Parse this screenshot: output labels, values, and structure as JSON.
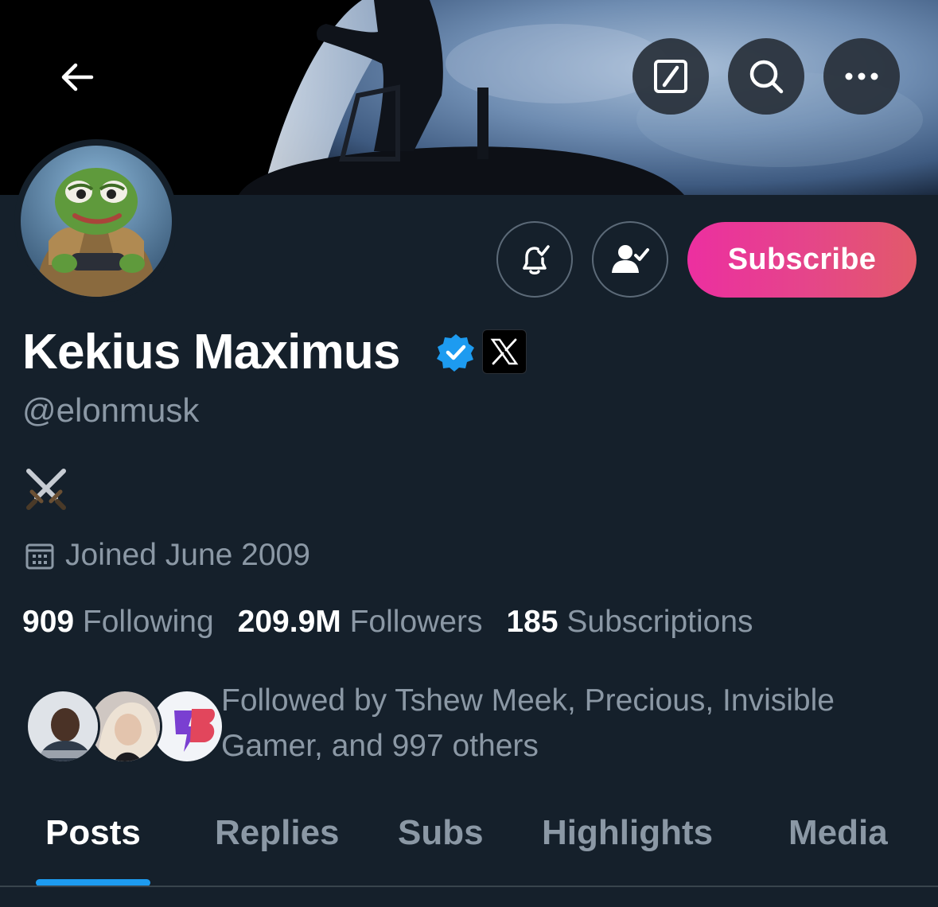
{
  "profile": {
    "display_name": "Kekius Maximus",
    "handle": "@elonmusk",
    "bio": "⚔️",
    "joined": "Joined June 2009",
    "affiliate_badge": "𝕏"
  },
  "header": {
    "back_icon": "arrow-left-icon",
    "actions": [
      "grok-icon",
      "search-icon",
      "more-icon"
    ]
  },
  "actions": {
    "notification_icon": "bell-check-icon",
    "following_icon": "person-check-icon",
    "subscribe_label": "Subscribe"
  },
  "stats": {
    "following_count": "909",
    "following_label": "Following",
    "followers_count": "209.9M",
    "followers_label": "Followers",
    "subscriptions_count": "185",
    "subscriptions_label": "Subscriptions"
  },
  "followed_by": {
    "text": "Followed by Tshew Meek, Precious, Invisible Gamer, and 997 others"
  },
  "tabs": [
    {
      "label": "Posts",
      "active": true
    },
    {
      "label": "Replies",
      "active": false
    },
    {
      "label": "Subs",
      "active": false
    },
    {
      "label": "Highlights",
      "active": false
    },
    {
      "label": "Media",
      "active": false
    }
  ],
  "colors": {
    "background": "#15202b",
    "accent": "#1d9bf0",
    "secondary_text": "#8b98a5",
    "subscribe_gradient_start": "#ec2fa0",
    "subscribe_gradient_end": "#e25a6a"
  }
}
